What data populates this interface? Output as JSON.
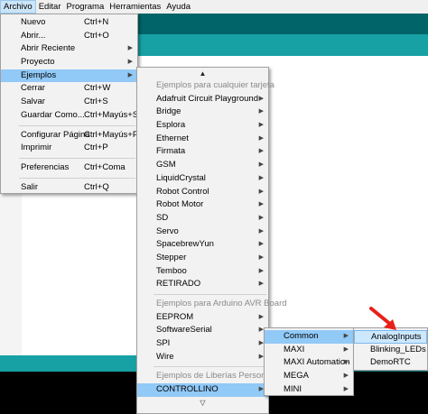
{
  "menubar": {
    "items": [
      "Archivo",
      "Editar",
      "Programa",
      "Herramientas",
      "Ayuda"
    ]
  },
  "archivo_menu": {
    "items": [
      {
        "label": "Nuevo",
        "shortcut": "Ctrl+N"
      },
      {
        "label": "Abrir...",
        "shortcut": "Ctrl+O"
      },
      {
        "label": "Abrir Reciente",
        "submenu": true
      },
      {
        "label": "Proyecto",
        "submenu": true
      },
      {
        "label": "Ejemplos",
        "submenu": true,
        "highlighted": true
      },
      {
        "label": "Cerrar",
        "shortcut": "Ctrl+W"
      },
      {
        "label": "Salvar",
        "shortcut": "Ctrl+S"
      },
      {
        "label": "Guardar Como...",
        "shortcut": "Ctrl+Mayús+S"
      },
      {
        "label": "Configurar Página",
        "shortcut": "Ctrl+Mayús+P"
      },
      {
        "label": "Imprimir",
        "shortcut": "Ctrl+P"
      },
      {
        "label": "Preferencias",
        "shortcut": "Ctrl+Coma"
      },
      {
        "label": "Salir",
        "shortcut": "Ctrl+Q"
      }
    ]
  },
  "ejemplos_menu": {
    "scroll_up": "▲",
    "scroll_down": "▽",
    "header_any_board": "Ejemplos para cualquier tarjeta",
    "any_board_items": [
      "Adafruit Circuit Playground",
      "Bridge",
      "Esplora",
      "Ethernet",
      "Firmata",
      "GSM",
      "LiquidCrystal",
      "Robot Control",
      "Robot Motor",
      "SD",
      "Servo",
      "SpacebrewYun",
      "Stepper",
      "Temboo",
      "RETIRADO"
    ],
    "header_avr": "Ejemplos para Arduino AVR Board",
    "avr_items": [
      "EEPROM",
      "SoftwareSerial",
      "SPI",
      "Wire"
    ],
    "header_libs": "Ejemplos de Liberías Personalizadas",
    "lib_items": [
      "CONTROLLINO"
    ]
  },
  "controllino_menu": {
    "items": [
      "Common",
      "MAXI",
      "MAXI Automation",
      "MEGA",
      "MINI"
    ]
  },
  "common_menu": {
    "items": [
      "AnalogInputs",
      "Blinking_LEDs",
      "DemoRTC"
    ]
  },
  "colors": {
    "teal_dark": "#006468",
    "teal_light": "#17a1a5",
    "menu_highlight": "#91c9f7",
    "annotation_arrow": "#e8201a"
  },
  "icons": {
    "submenu_arrow": "chevron-right-icon",
    "annotation": "red-pointer-arrow-icon"
  }
}
